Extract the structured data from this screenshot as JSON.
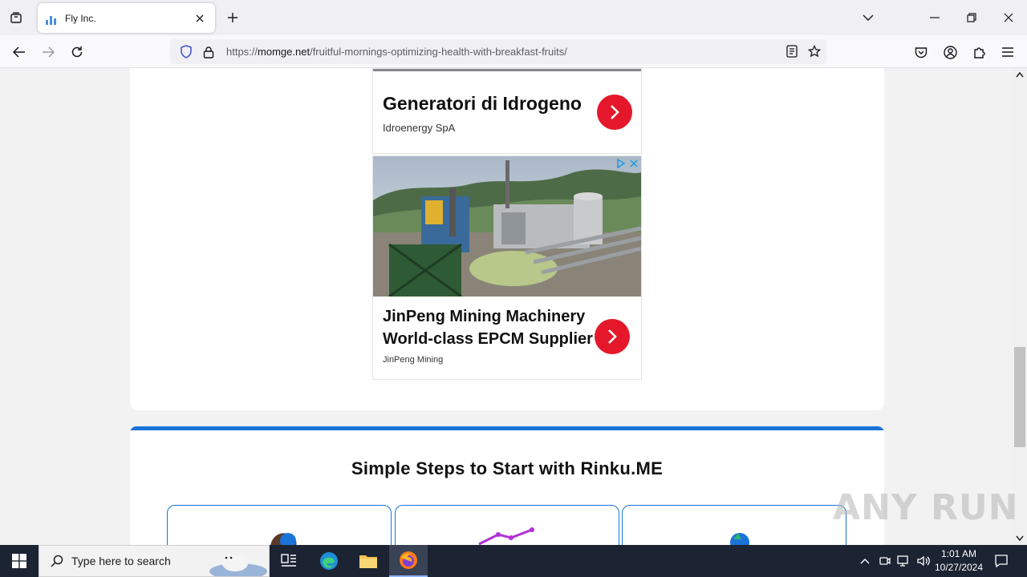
{
  "browser": {
    "tab": {
      "title": "Fly Inc."
    },
    "url": {
      "prefix": "https://",
      "domain": "momge.net",
      "path": "/fruitful-mornings-optimizing-health-with-breakfast-fruits/"
    }
  },
  "ads": [
    {
      "title": "Generatori di Idrogeno",
      "advertiser": "Idroenergy SpA"
    },
    {
      "title_line1": "JinPeng Mining Machinery",
      "title_line2": "World-class EPCM Supplier",
      "advertiser": "JinPeng Mining"
    }
  ],
  "section": {
    "title": "Simple Steps to Start with Rinku.ME"
  },
  "watermark": "ANY RUN",
  "taskbar": {
    "search_placeholder": "Type here to search",
    "time": "1:01 AM",
    "date": "10/27/2024"
  },
  "colors": {
    "accent": "#1a73d9",
    "ad_button": "#e5182b",
    "taskbar": "#1c2333"
  }
}
